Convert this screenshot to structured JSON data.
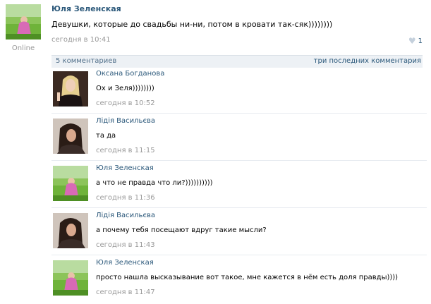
{
  "post": {
    "author": "Юля Зеленская",
    "text": "Девушки, которые до свадьбы ни-ни, потом в кровати так-сяк))))))))",
    "time": "сегодня в 10:41",
    "likes": "1",
    "status": "Online"
  },
  "comments_bar": {
    "count_label": "5 комментариев",
    "last_label": "три последних комментария"
  },
  "comments": [
    {
      "author": "Оксана Богданова",
      "text": "Ох и Зеля))))))))",
      "time": "сегодня в 10:52",
      "avatar": "blonde"
    },
    {
      "author": "Лідія Васильєва",
      "text": "та да",
      "time": "сегодня в 11:15",
      "avatar": "dark"
    },
    {
      "author": "Юля Зеленская",
      "text": "а что не правда что ли?))))))))))",
      "time": "сегодня в 11:36",
      "avatar": "meadow"
    },
    {
      "author": "Лідія Васильєва",
      "text": "а почему тебя посещают вдруг такие мысли?",
      "time": "сегодня в 11:43",
      "avatar": "dark"
    },
    {
      "author": "Юля Зеленская",
      "text": "просто нашла высказывание вот такое, мне кажется в нём есть доля правды))))",
      "time": "сегодня в 11:47",
      "avatar": "meadow"
    }
  ],
  "colors": {
    "link": "#2b587a",
    "muted": "#999999",
    "bar_bg": "#edf1f5"
  },
  "icons": {
    "like": "heart-icon"
  }
}
